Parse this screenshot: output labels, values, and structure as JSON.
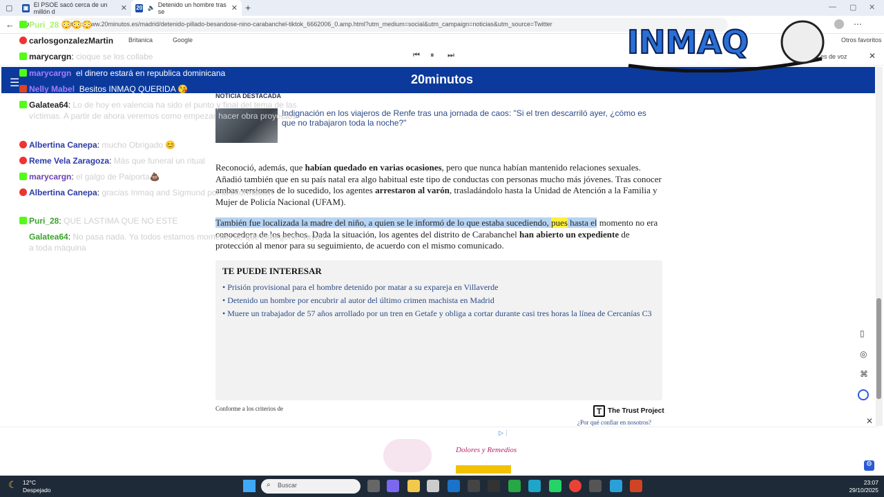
{
  "browser": {
    "tabs": [
      {
        "label": "El PSOE sacó cerca de un millón d",
        "active": false
      },
      {
        "label": "Detenido un hombre tras se",
        "active": true
      }
    ],
    "new_tab": "+",
    "url": "https://www.20minutos.es/madrid/detenido-pillado-besandose-nino-carabanchel-tiktok_6662006_0.amp.html?utm_medium=social&utm_campaign=noticias&utm_source=Twitter",
    "favorites_other": "Otros favoritos",
    "favorites": [
      "Britanica",
      "Google"
    ],
    "reader_voice": "es de voz"
  },
  "site": {
    "logo": "20minutos",
    "featured_label": "NOTICIA DESTACADA",
    "featured_title": "Indignación en los viajeros de Renfe tras una jornada de caos: \"Si el tren descarriló ayer, ¿cómo es que no trabajaron toda la noche?\"",
    "p1_a": "Reconoció, además, que ",
    "p1_b": "habían quedado en varias ocasiones",
    "p1_c": ", pero que nunca habían mantenido relaciones sexuales. Añadió también que en su país natal era algo habitual este tipo de conductas con personas mucho más jóvenes. Tras conocer ambas versiones de lo sucedido, los agentes ",
    "p1_d": "arrestaron al varón",
    "p1_e": ", trasladándolo hasta la Unidad de Atención a la Familia y Mujer de Policía Nacional (UFAM).",
    "p2_a": "También fue localizada la madre del niño, a quien se le informó de lo que estaba sucediendo, ",
    "p2_b": "pues",
    "p2_c": " hasta el",
    "p2_d": "momento no era conocedora de los hechos. Dada la situación, los agentes del distrito de Carabanchel ",
    "p2_e": "han abierto un expediente",
    "p2_f": " de protección al menor para su seguimiento, de acuerdo con el mismo comunicado.",
    "interest_title": "TE PUEDE INTERESAR",
    "interest_links": [
      "Prisión provisional para el hombre detenido por matar a su expareja en Villaverde",
      "Detenido un hombre por encubrir al autor del último crimen machista en Madrid",
      "Muere un trabajador de 57 años arrollado por un tren en Getafe y obliga a cortar durante casi tres horas la línea de Cercanías C3"
    ],
    "trust_left": "Conforme a los criterios de",
    "trust_name": "The Trust Project",
    "trust_question": "¿Por qué confiar en nosotros?",
    "ad_brand": "Dolores y Remedios"
  },
  "chat": [
    {
      "user": "Puri_28",
      "msg": ":😳😳😳",
      "platform": "kick",
      "color": "#a7f36b"
    },
    {
      "user": "carlosgonzalezMartin",
      "msg": "",
      "platform": "youtube",
      "color": "#ffffff"
    },
    {
      "user": "marycargn",
      "msg": "cioque se los collabe",
      "platform": "kick",
      "color": "#ffffff"
    },
    {
      "user": "marycargn",
      "msg": "el dinero estará en republica dominicana",
      "platform": "kick",
      "color": "#a77bff"
    },
    {
      "user": "Nelly Mabel",
      "msg": "Besitos INMAQ QUERIDA 😘",
      "platform": "youtube",
      "color": "#a77bff"
    },
    {
      "user": "Galatea64",
      "msg": "Lo de hoy en valencia ha sido el punto y final del tema de las víctimas. A partir de ahora veremos como empezar hacer obra proyectos",
      "platform": "kick",
      "color": "#a7f36b"
    },
    {
      "user": "Albertina Canepa",
      "msg": "mucho Obrigado 😊",
      "platform": "youtube",
      "color": "#7a8cff"
    },
    {
      "user": "Reme Vela Zaragoza",
      "msg": "Más que funeral un ritual",
      "platform": "youtube",
      "color": "#7a8cff"
    },
    {
      "user": "marycargn",
      "msg": "el galgo de Paiporta💩",
      "platform": "kick",
      "color": "#a77bff"
    },
    {
      "user": "Albertina Canepa",
      "msg": "gracias Inmaq and Sigmund por la información",
      "platform": "youtube",
      "color": "#7a8cff"
    },
    {
      "user": "Puri_28",
      "msg": "QUE LASTIMA QUE NO ESTE",
      "platform": "kick",
      "color": "#a7f36b"
    },
    {
      "user": "Galatea64",
      "msg": "No pasa nada. Ya todos estamos momento de que esta gente vayan a toda máquina",
      "platform": "kick",
      "color": "#a7f36b"
    }
  ],
  "overlay": {
    "brand": "INMAQ"
  },
  "taskbar": {
    "temp": "12°C",
    "weather": "Despejado",
    "search_placeholder": "Buscar",
    "time": "23:07",
    "date": "29/10/2025"
  }
}
